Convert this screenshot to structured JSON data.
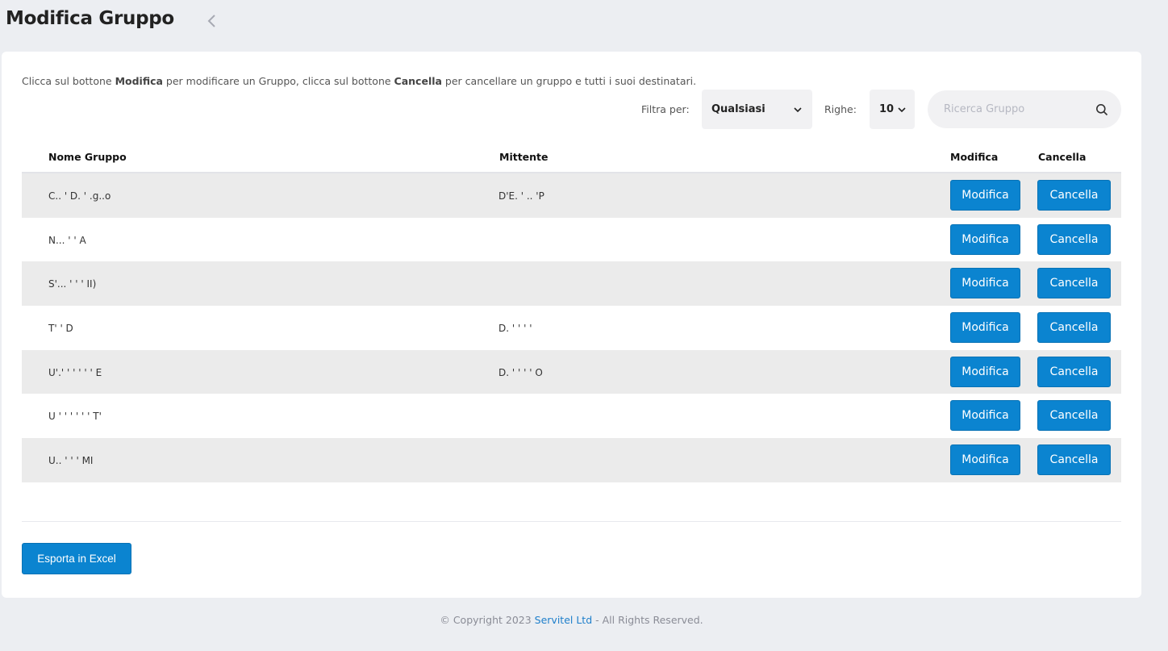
{
  "header": {
    "title": "Modifica Gruppo",
    "back_icon": "chevron-left-icon"
  },
  "intro": {
    "part1": "Clicca sul bottone ",
    "bold1": "Modifica",
    "part2": " per modificare un Gruppo, clicca sul bottone ",
    "bold2": "Cancella",
    "part3": " per cancellare un gruppo e tutti i suoi destinatari."
  },
  "filters": {
    "filter_label": "Filtra per:",
    "filter_value": "Qualsiasi",
    "rows_label": "Righe:",
    "rows_value": "10",
    "search_placeholder": "Ricerca Gruppo"
  },
  "table": {
    "columns": {
      "name": "Nome Gruppo",
      "sender": "Mittente",
      "edit": "Modifica",
      "delete": "Cancella"
    },
    "rows": [
      {
        "name": "C.. ' D. ' .g..o",
        "sender": "D'E. ' .. 'P"
      },
      {
        "name": "N... ' ' A",
        "sender": ""
      },
      {
        "name": "S'...  ' ' ' II)",
        "sender": ""
      },
      {
        "name": "T' ' D",
        "sender": "D.  ' ' ' '"
      },
      {
        "name": "U'.' ' ' ' ' ' E",
        "sender": "D.  ' ' ' ' O"
      },
      {
        "name": "U ' ' ' ' ' ' T'",
        "sender": ""
      },
      {
        "name": "U.. ' ' ' MI",
        "sender": ""
      }
    ],
    "edit_label": "Modifica",
    "delete_label": "Cancella"
  },
  "export_label": "Esporta in Excel",
  "footer": {
    "prefix": "© Copyright 2023 ",
    "company": "Servitel Ltd",
    "suffix": " - All Rights Reserved."
  },
  "colors": {
    "primary": "#0b84d0",
    "background": "#eceef2",
    "row_alt": "#ebebeb"
  }
}
